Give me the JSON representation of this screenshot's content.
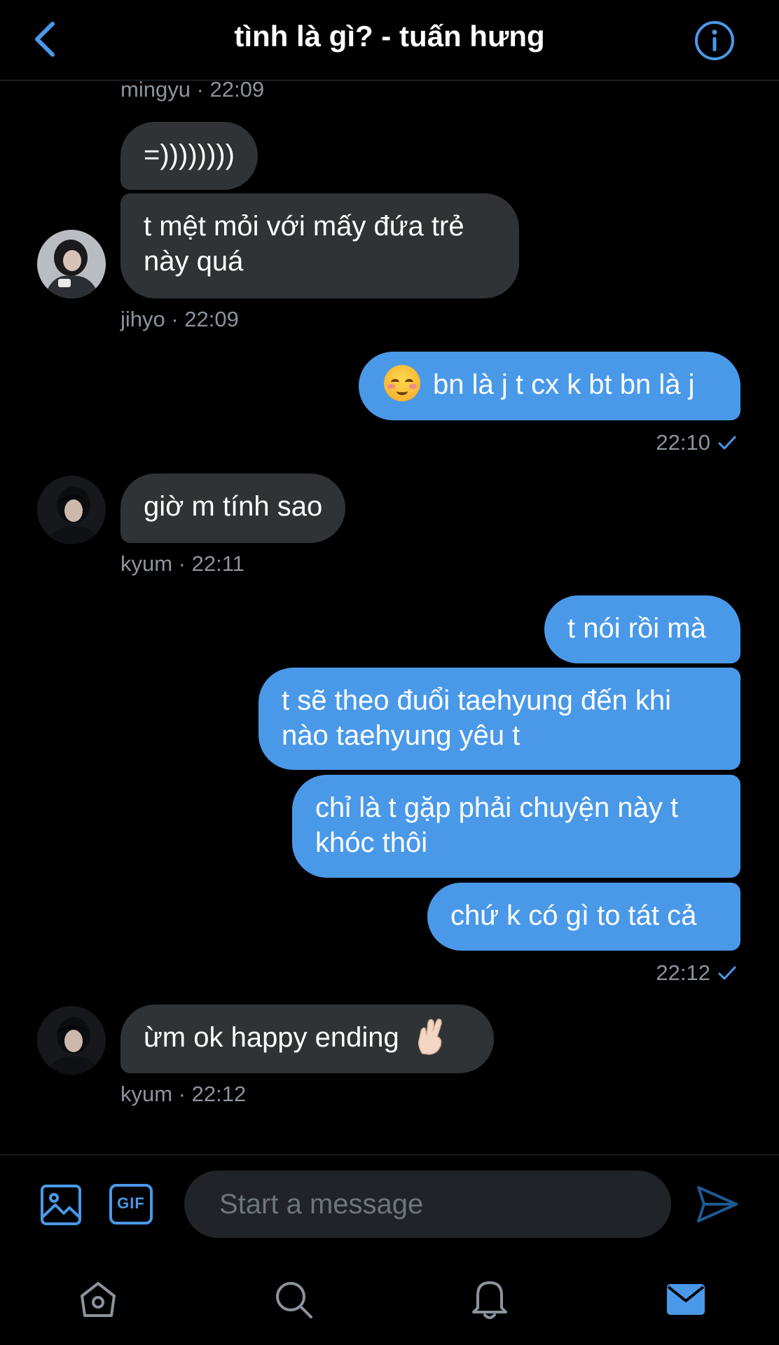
{
  "header": {
    "title": "tình là gì? - tuấn hưng"
  },
  "messages": [
    {
      "meta": "mingyu · 22:09"
    },
    {
      "text": "=))))))))"
    },
    {
      "text_line1": "t mệt mỏi với mấy đứa trẻ",
      "text_line2": "này quá"
    },
    {
      "meta": "jihyo · 22:09"
    },
    {
      "text": "bn là j t cx k bt bn là j",
      "emoji": "relieved-face"
    },
    {
      "meta": "22:10"
    },
    {
      "text": "giờ m tính sao"
    },
    {
      "meta": "kyum · 22:11"
    },
    {
      "text": "t nói rồi mà"
    },
    {
      "text_line1": "t sẽ theo đuổi taehyung đến khi",
      "text_line2": "nào taehyung yêu t"
    },
    {
      "text_line1": "chỉ là t gặp phải chuyện này t",
      "text_line2": "khóc thôi"
    },
    {
      "text": "chứ k có gì to tát cả"
    },
    {
      "meta": "22:12"
    },
    {
      "text": "ừm ok happy ending",
      "emoji": "crossed-fingers"
    },
    {
      "meta": "kyum · 22:12"
    }
  ],
  "composer": {
    "placeholder": "Start a message",
    "gif_label": "GIF"
  },
  "colors": {
    "accent": "#4a99e9",
    "incoming_bubble": "#2f3336",
    "meta_text": "#8b949e",
    "background": "#000000"
  },
  "icons": {
    "back": "chevron-left-icon",
    "info": "info-icon",
    "image": "image-icon",
    "gif": "gif-icon",
    "send": "send-icon",
    "home": "home-icon",
    "search": "search-icon",
    "notifications": "bell-icon",
    "messages": "mail-icon"
  }
}
